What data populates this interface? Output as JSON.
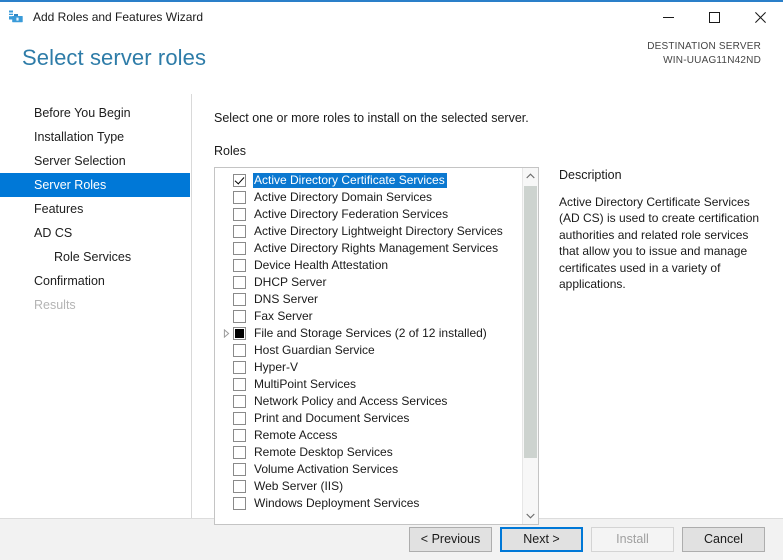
{
  "window": {
    "title": "Add Roles and Features Wizard",
    "icon": "server-manager-toolbox-icon",
    "minimize_label": "Minimize",
    "maximize_label": "Maximize",
    "close_label": "Close",
    "accent_color": "#2a7fc9"
  },
  "header": {
    "page_title": "Select server roles",
    "destination_label": "DESTINATION SERVER",
    "destination_server": "WIN-UUAG11N42ND",
    "title_color": "#2e7ca8"
  },
  "navigation": {
    "selected_color": "#0078d7",
    "items": [
      {
        "label": "Before You Begin",
        "state": "normal",
        "indent": false
      },
      {
        "label": "Installation Type",
        "state": "normal",
        "indent": false
      },
      {
        "label": "Server Selection",
        "state": "normal",
        "indent": false
      },
      {
        "label": "Server Roles",
        "state": "selected",
        "indent": false
      },
      {
        "label": "Features",
        "state": "normal",
        "indent": false
      },
      {
        "label": "AD CS",
        "state": "normal",
        "indent": false
      },
      {
        "label": "Role Services",
        "state": "normal",
        "indent": true
      },
      {
        "label": "Confirmation",
        "state": "normal",
        "indent": false
      },
      {
        "label": "Results",
        "state": "disabled",
        "indent": false
      }
    ]
  },
  "main": {
    "instruction": "Select one or more roles to install on the selected server.",
    "roles_label": "Roles",
    "selection_color": "#0b78d0",
    "roles": [
      {
        "label": "Active Directory Certificate Services",
        "checkbox": "checked",
        "selected": true,
        "expandable": false
      },
      {
        "label": "Active Directory Domain Services",
        "checkbox": "unchecked",
        "selected": false,
        "expandable": false
      },
      {
        "label": "Active Directory Federation Services",
        "checkbox": "unchecked",
        "selected": false,
        "expandable": false
      },
      {
        "label": "Active Directory Lightweight Directory Services",
        "checkbox": "unchecked",
        "selected": false,
        "expandable": false
      },
      {
        "label": "Active Directory Rights Management Services",
        "checkbox": "unchecked",
        "selected": false,
        "expandable": false
      },
      {
        "label": "Device Health Attestation",
        "checkbox": "unchecked",
        "selected": false,
        "expandable": false
      },
      {
        "label": "DHCP Server",
        "checkbox": "unchecked",
        "selected": false,
        "expandable": false
      },
      {
        "label": "DNS Server",
        "checkbox": "unchecked",
        "selected": false,
        "expandable": false
      },
      {
        "label": "Fax Server",
        "checkbox": "unchecked",
        "selected": false,
        "expandable": false
      },
      {
        "label": "File and Storage Services (2 of 12 installed)",
        "checkbox": "partial",
        "selected": false,
        "expandable": true
      },
      {
        "label": "Host Guardian Service",
        "checkbox": "unchecked",
        "selected": false,
        "expandable": false
      },
      {
        "label": "Hyper-V",
        "checkbox": "unchecked",
        "selected": false,
        "expandable": false
      },
      {
        "label": "MultiPoint Services",
        "checkbox": "unchecked",
        "selected": false,
        "expandable": false
      },
      {
        "label": "Network Policy and Access Services",
        "checkbox": "unchecked",
        "selected": false,
        "expandable": false
      },
      {
        "label": "Print and Document Services",
        "checkbox": "unchecked",
        "selected": false,
        "expandable": false
      },
      {
        "label": "Remote Access",
        "checkbox": "unchecked",
        "selected": false,
        "expandable": false
      },
      {
        "label": "Remote Desktop Services",
        "checkbox": "unchecked",
        "selected": false,
        "expandable": false
      },
      {
        "label": "Volume Activation Services",
        "checkbox": "unchecked",
        "selected": false,
        "expandable": false
      },
      {
        "label": "Web Server (IIS)",
        "checkbox": "unchecked",
        "selected": false,
        "expandable": false
      },
      {
        "label": "Windows Deployment Services",
        "checkbox": "unchecked",
        "selected": false,
        "expandable": false
      }
    ],
    "scrollbar": {
      "up_arrow": "chevron-up-icon",
      "down_arrow": "chevron-down-icon"
    }
  },
  "description": {
    "title": "Description",
    "text": "Active Directory Certificate Services (AD CS) is used to create certification authorities and related role services that allow you to issue and manage certificates used in a variety of applications."
  },
  "footer": {
    "previous_label": "< Previous",
    "next_label": "Next >",
    "install_label": "Install",
    "cancel_label": "Cancel",
    "focus_color": "#0078d7"
  }
}
